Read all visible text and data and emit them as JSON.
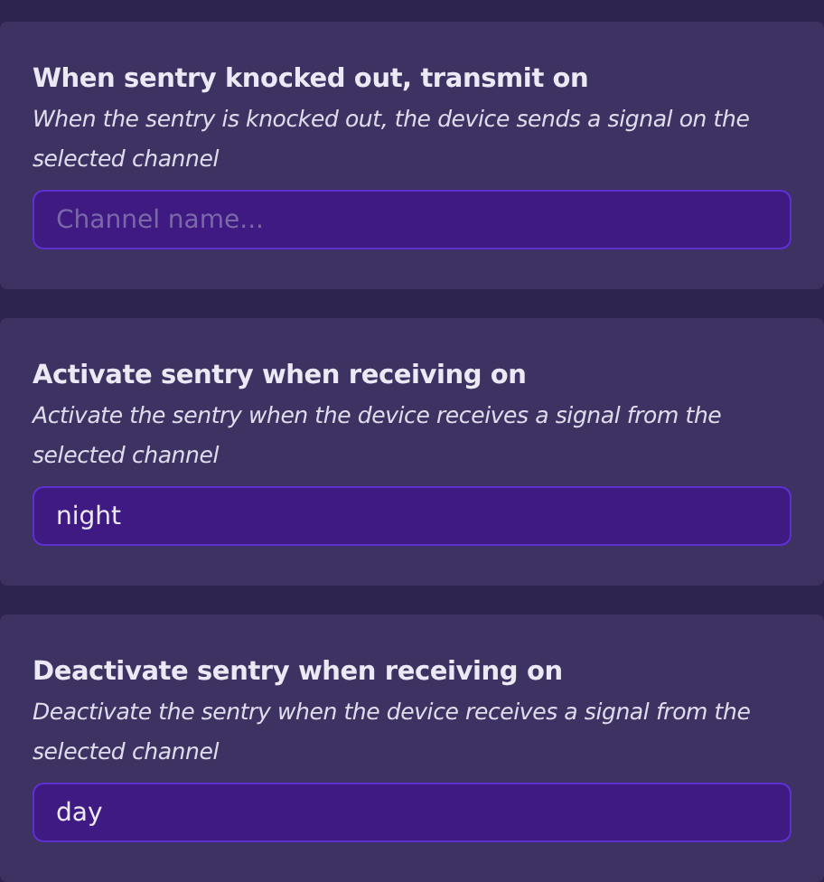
{
  "settings": [
    {
      "title": "When sentry knocked out, transmit on",
      "description": "When the sentry is knocked out, the device sends a signal on the selected channel",
      "field": {
        "placeholder": "Channel name..."
      }
    },
    {
      "title": "Activate sentry when receiving on",
      "description": "Activate the sentry when the device receives a signal from the selected channel",
      "field": {
        "value": "night"
      }
    },
    {
      "title": "Deactivate sentry when receiving on",
      "description": "Deactivate the sentry when the device receives a signal from the selected channel",
      "field": {
        "value": "day"
      }
    }
  ]
}
